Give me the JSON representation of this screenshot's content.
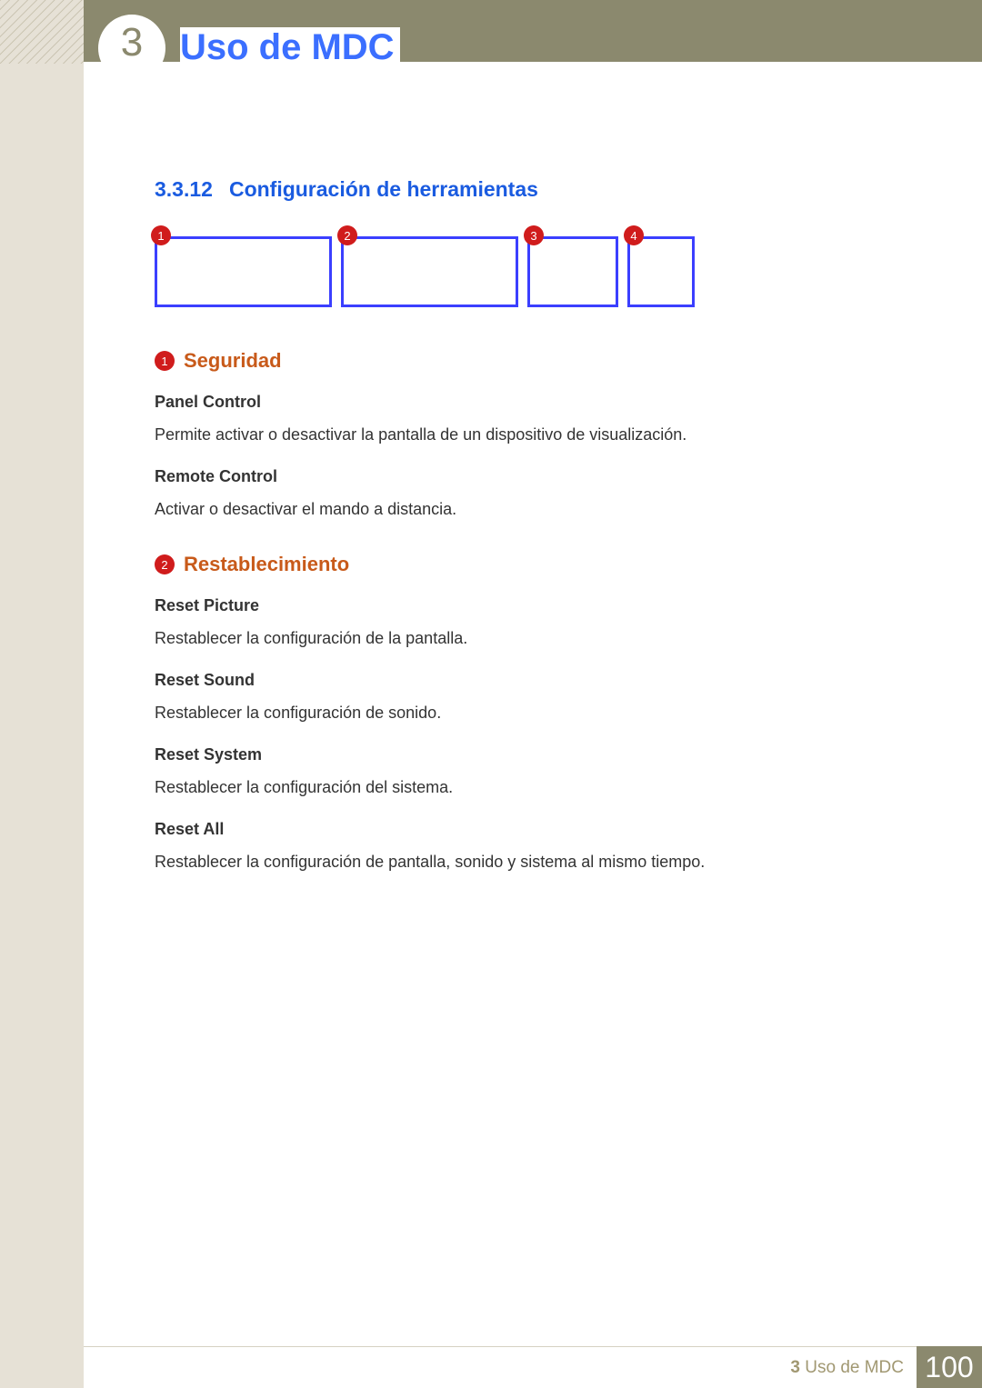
{
  "header": {
    "chapter_num": "3",
    "chapter_title": "Uso de MDC"
  },
  "section": {
    "number": "3.3.12",
    "title": "Configuración de herramientas"
  },
  "callouts": {
    "n1": "1",
    "n2": "2",
    "n3": "3",
    "n4": "4"
  },
  "groups": [
    {
      "num": "1",
      "title": "Seguridad",
      "items": [
        {
          "title": "Panel Control",
          "desc": "Permite activar o desactivar la pantalla de un dispositivo de visualización."
        },
        {
          "title": "Remote Control",
          "desc": "Activar o desactivar el mando a distancia."
        }
      ]
    },
    {
      "num": "2",
      "title": "Restablecimiento",
      "items": [
        {
          "title": "Reset Picture",
          "desc": "Restablecer la configuración de la pantalla."
        },
        {
          "title": "Reset Sound",
          "desc": "Restablecer la configuración de sonido."
        },
        {
          "title": "Reset System",
          "desc": "Restablecer la configuración del sistema."
        },
        {
          "title": "Reset All",
          "desc": "Restablecer la configuración de pantalla, sonido y sistema al mismo tiempo."
        }
      ]
    }
  ],
  "footer": {
    "chapter_num": "3",
    "chapter_title": "Uso de MDC",
    "page": "100"
  }
}
